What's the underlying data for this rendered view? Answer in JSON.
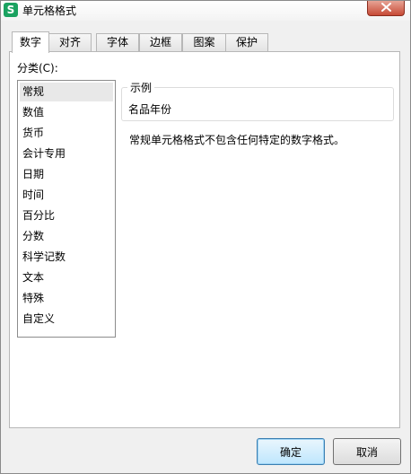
{
  "window": {
    "title": "单元格格式",
    "app_icon_letter": "S",
    "app_icon_color": "#1aa260",
    "close_color": "#c74a36"
  },
  "tabs": [
    {
      "label": "数字",
      "active": true
    },
    {
      "label": "对齐",
      "active": false
    },
    {
      "label": "字体",
      "active": false
    },
    {
      "label": "边框",
      "active": false
    },
    {
      "label": "图案",
      "active": false
    },
    {
      "label": "保护",
      "active": false
    }
  ],
  "number_tab": {
    "category_label": "分类(C):",
    "categories": [
      "常规",
      "数值",
      "货币",
      "会计专用",
      "日期",
      "时间",
      "百分比",
      "分数",
      "科学记数",
      "文本",
      "特殊",
      "自定义"
    ],
    "selected_category": "常规",
    "sample": {
      "legend": "示例",
      "value": "名品年份"
    },
    "description": "常规单元格格式不包含任何特定的数字格式。"
  },
  "buttons": {
    "ok": "确定",
    "cancel": "取消"
  }
}
